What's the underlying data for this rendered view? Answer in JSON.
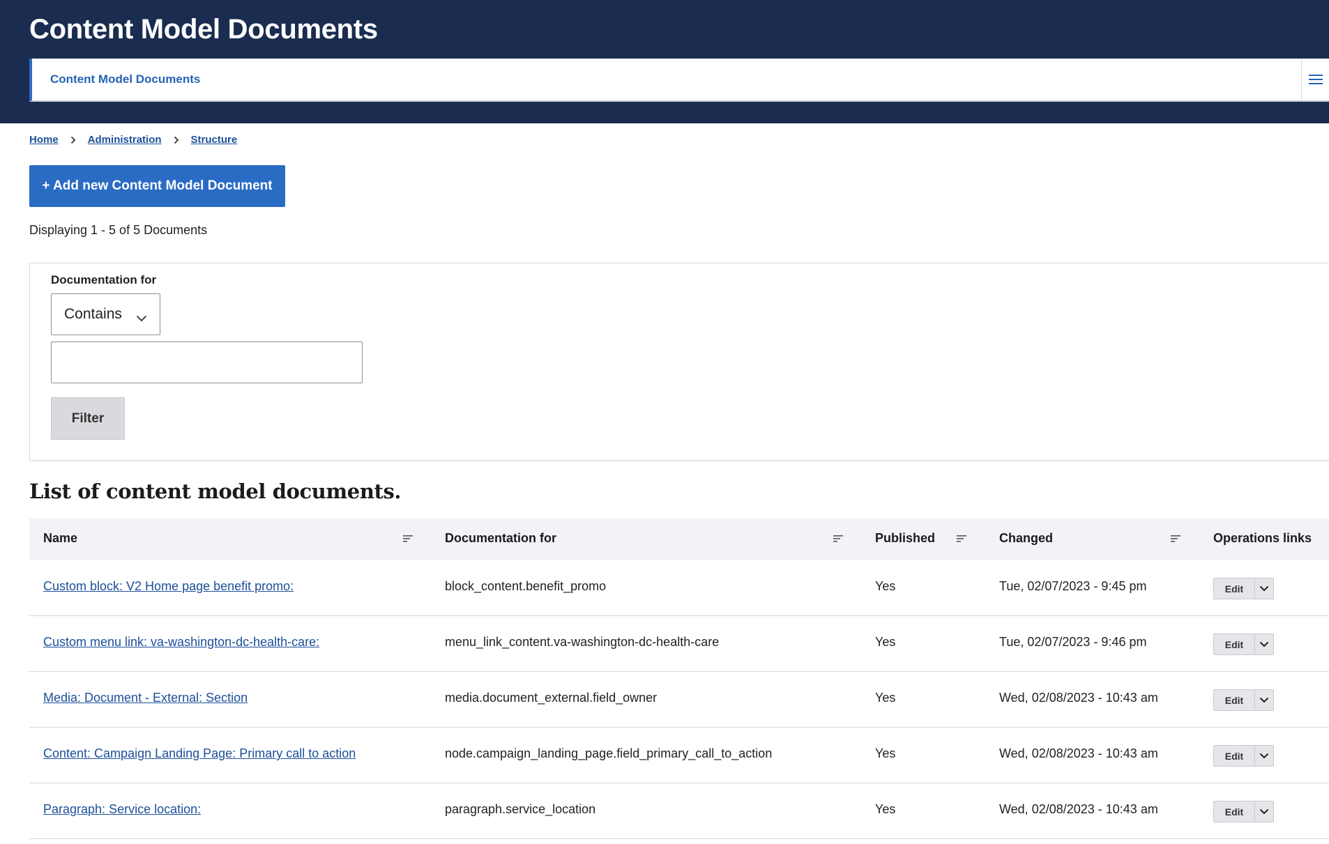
{
  "header": {
    "site_title": "Content Model Documents",
    "active_tab": "Content Model Documents",
    "menu_toggle_icon": "hamburger-menu-icon"
  },
  "breadcrumb": [
    "Home",
    "Administration",
    "Structure"
  ],
  "actions": {
    "add_label": "+ Add new Content Model Document"
  },
  "summary": "Displaying 1 - 5 of 5 Documents",
  "filter": {
    "label": "Documentation for",
    "operator": "Contains",
    "value": "",
    "button": "Filter"
  },
  "table": {
    "caption": "List of content model documents.",
    "columns": {
      "name": "Name",
      "documentation_for": "Documentation for",
      "published": "Published",
      "changed": "Changed",
      "operations": "Operations links"
    },
    "rows": [
      {
        "name": "Custom block: V2 Home page benefit promo:",
        "documentation_for": "block_content.benefit_promo",
        "published": "Yes",
        "changed": "Tue, 02/07/2023 - 9:45 pm",
        "op_label": "Edit"
      },
      {
        "name": "Custom menu link: va-washington-dc-health-care:",
        "documentation_for": "menu_link_content.va-washington-dc-health-care",
        "published": "Yes",
        "changed": "Tue, 02/07/2023 - 9:46 pm",
        "op_label": "Edit"
      },
      {
        "name": "Media: Document - External: Section",
        "documentation_for": "media.document_external.field_owner",
        "published": "Yes",
        "changed": "Wed, 02/08/2023 - 10:43 am",
        "op_label": "Edit"
      },
      {
        "name": "Content: Campaign Landing Page: Primary call to action",
        "documentation_for": "node.campaign_landing_page.field_primary_call_to_action",
        "published": "Yes",
        "changed": "Wed, 02/08/2023 - 10:43 am",
        "op_label": "Edit"
      },
      {
        "name": "Paragraph: Service location:",
        "documentation_for": "paragraph.service_location",
        "published": "Yes",
        "changed": "Wed, 02/08/2023 - 10:43 am",
        "op_label": "Edit"
      }
    ]
  },
  "colors": {
    "header_bg": "#1a2d50",
    "primary_button": "#2a6bc4",
    "link": "#1d4f9a"
  }
}
